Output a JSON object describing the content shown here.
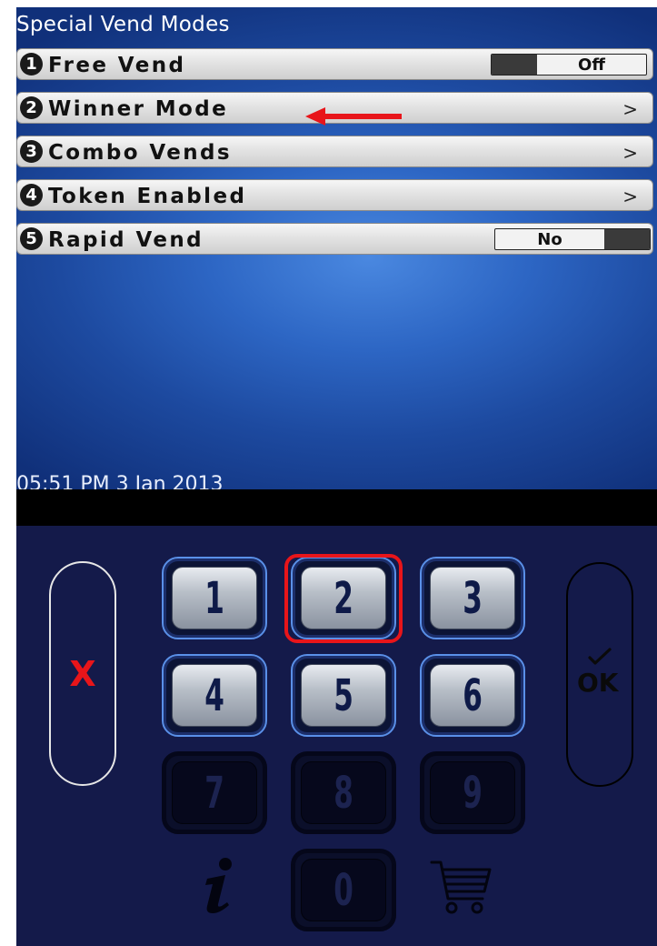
{
  "screen": {
    "title": "Special Vend Modes",
    "menu_items": [
      {
        "number": "1",
        "label": "Free Vend",
        "control": "toggle",
        "value": "Off"
      },
      {
        "number": "2",
        "label": "Winner Mode",
        "control": "chevron",
        "chevron": ">"
      },
      {
        "number": "3",
        "label": "Combo Vends",
        "control": "chevron",
        "chevron": ">"
      },
      {
        "number": "4",
        "label": "Token Enabled",
        "control": "chevron",
        "chevron": ">"
      },
      {
        "number": "5",
        "label": "Rapid Vend",
        "control": "toggle",
        "value": "No"
      }
    ],
    "datetime": "05:51 PM 3 Jan 2013"
  },
  "keypad": {
    "keys": [
      "1",
      "2",
      "3",
      "4",
      "5",
      "6",
      "7",
      "8",
      "9",
      "0"
    ],
    "disabled_keys": [
      "7",
      "8",
      "9",
      "0"
    ],
    "highlighted_key": "2",
    "cancel_symbol": "X",
    "ok_label": "OK"
  },
  "colors": {
    "annotation_red": "#e8151a",
    "screen_blue": "#2d66c4",
    "panel_navy": "#141a4a",
    "key_border_blue": "#5a90e8"
  },
  "icons": [
    "cancel-x-icon",
    "ok-check-icon",
    "info-icon",
    "shopping-cart-icon",
    "annotation-arrow-icon"
  ]
}
